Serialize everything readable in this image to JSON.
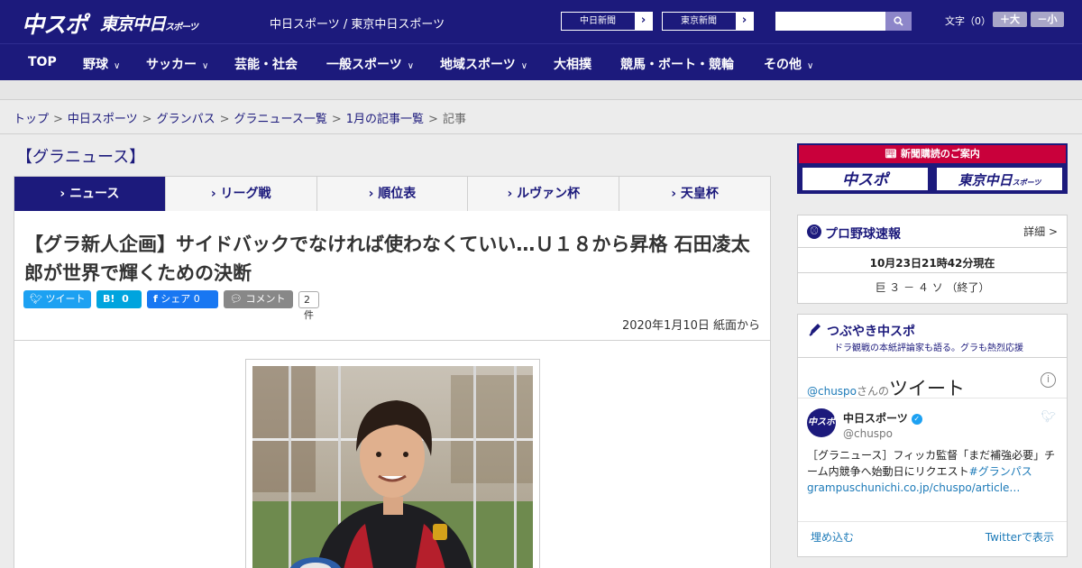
{
  "header": {
    "logo_chuspo": "中スポ",
    "logo_tokyo": "東京中日",
    "logo_tokyo_sub": "スポーツ",
    "site_title": "中日スポーツ / 東京中日スポーツ",
    "paper_links": [
      "中日新聞",
      "東京新聞"
    ],
    "search_placeholder": "",
    "fontsize_label": "文字（0）",
    "font_larger": "＋大",
    "font_smaller": "－小"
  },
  "nav": {
    "items": [
      "TOP",
      "野球",
      "サッカー",
      "芸能・社会",
      "一般スポーツ",
      "地域スポーツ",
      "大相撲",
      "競馬・ボート・競輪",
      "その他"
    ]
  },
  "breadcrumb": {
    "links": [
      "トップ",
      "中日スポーツ",
      "グランパス",
      "グラニュース一覧",
      "1月の記事一覧"
    ],
    "current": "記事",
    "separator": ">"
  },
  "section": {
    "heading": "【グラニュース】",
    "tabs": [
      "ニュース",
      "リーグ戦",
      "順位表",
      "ルヴァン杯",
      "天皇杯"
    ],
    "active_tab": 0
  },
  "article": {
    "title": "【グラ新人企画】サイドバックでなければ使わなくていい…Ｕ１８から昇格 石田凌太郎が世界で輝くための決断",
    "share": {
      "tweet": "ツイート",
      "hatena_label": "B!",
      "hatena_count": "0",
      "facebook": "シェア 0",
      "comment": "コメント",
      "comment_count": "2件"
    },
    "date": "2020年1月10日 紙面から"
  },
  "sidebar": {
    "ad_banner": "新聞購読のご案内",
    "ad_chuspo": "中スポ",
    "ad_tokyo": "東京中日",
    "ad_tokyo_sub": "スポーツ",
    "baseball": {
      "title": "プロ野球速報",
      "detail": "詳細 >",
      "time": "10月23日21時42分現在",
      "score": "巨 ３ － ４ ソ （終了）"
    },
    "twitter": {
      "title": "つぶやき中スポ",
      "subtitle": "ドラ観戦の本紙評論家も語る。グラも熱烈応援",
      "handle_link": "@chuspo",
      "handle_suffix": "さんの",
      "tweets_label": "ツイート",
      "account_name": "中日スポーツ",
      "account_handle": "@chuspo",
      "avatar_text": "中スポ",
      "tweet_text_1": "［グラニュース］フィッカ監督「まだ補強必要」チーム内競争へ始動日にリクエスト",
      "tweet_hashtag": "#グランパス",
      "tweet_url": "grampuschunichi.co.jp/chuspo/article…",
      "embed": "埋め込む",
      "view_on": "Twitterで表示"
    }
  },
  "colors": {
    "brand_navy": "#1c1a7c",
    "ad_red": "#c9003b",
    "twitter_blue": "#1da1f2",
    "facebook_blue": "#1877f2",
    "hatena_blue": "#00a4de",
    "comment_gray": "#888888"
  }
}
